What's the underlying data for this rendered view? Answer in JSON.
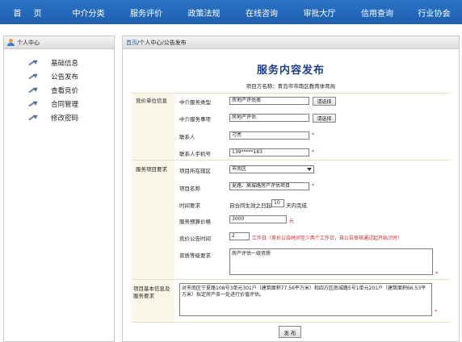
{
  "nav": {
    "items": [
      "首 页",
      "中介分类",
      "服务评价",
      "政策法规",
      "在线咨询",
      "审批大厅",
      "信用查询",
      "行业协会"
    ]
  },
  "sidebar": {
    "header": "个人中心",
    "items": [
      "基础信息",
      "公告发布",
      "查看竞价",
      "合同管理",
      "修改密码"
    ]
  },
  "breadcrumb": {
    "home": "首页",
    "rest": "/个人中心/公告发布"
  },
  "page": {
    "title": "服务内容发布",
    "subtitle": "项目方名称：青岛市市南区教育体育局"
  },
  "form": {
    "section_bidder": "竞价单位信息",
    "section_project": "服务项目要求",
    "section_basic": "项目基本信息及服务要求",
    "service_type_label": "中介服务类型",
    "service_type_value": "房地产评估类",
    "service_item_label": "中介服务事项",
    "service_item_value": "房地产评估",
    "choose_button": "请选择",
    "contact_label": "联系人",
    "contact_value": "刁亮",
    "phone_label": "联系人手机号",
    "phone_value": "139*****183",
    "district_label": "项目所在辖区",
    "district_value": "市南区",
    "project_name_label": "项目名称",
    "project_name_value": "夏路、高城路房产评估项目",
    "time_req_label": "时间要求",
    "time_req_prefix": "自合同生效之日起",
    "time_req_days": "10",
    "time_req_suffix": "天内完成",
    "budget_label": "服务预算价格",
    "budget_value": "3000",
    "budget_unit": "元",
    "notice_time_label": "竞价公告时间",
    "notice_time_value": "2",
    "notice_time_note": "工作日（竞价公告时间至少两个工作日，自公告审核通过起开始计时）",
    "qualification_label": "资质等级要求",
    "qualification_value": "房产评估一级资质",
    "basic_info_value": "对市南区宁夏路108号3单元301户（建筑面积77.56平方米）和四方区南城路5号1单元201户（建筑面积66.53平方米）拟定房产各一处进行价值评估。",
    "star": "*",
    "submit_label": "发 布"
  }
}
